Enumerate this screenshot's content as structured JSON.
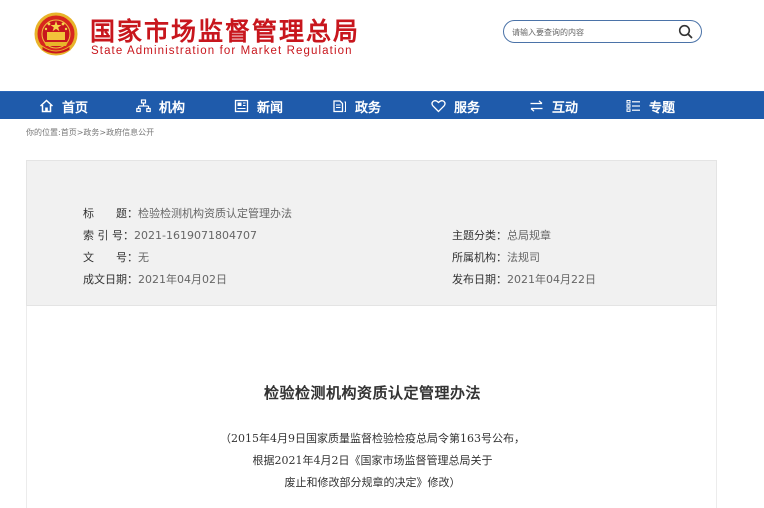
{
  "header": {
    "site_title": "国家市场监督管理总局",
    "site_subtitle": "State Administration for Market Regulation",
    "emblem_icon": "national-emblem-icon",
    "search_placeholder": "请输入要查询的内容",
    "brand_red": "#c8161d"
  },
  "nav": {
    "bg_color": "#1f5bab",
    "items": [
      {
        "label": "首页",
        "icon": "home-icon"
      },
      {
        "label": "机构",
        "icon": "org-chart-icon"
      },
      {
        "label": "新闻",
        "icon": "news-icon"
      },
      {
        "label": "政务",
        "icon": "government-affairs-icon"
      },
      {
        "label": "服务",
        "icon": "heart-icon"
      },
      {
        "label": "互动",
        "icon": "exchange-arrows-icon"
      },
      {
        "label": "专题",
        "icon": "topics-list-icon"
      }
    ]
  },
  "breadcrumb": "你的位置:首页>政务>政府信息公开",
  "meta": {
    "title_label": "标　　题：",
    "title_value": "检验检测机构资质认定管理办法",
    "index_label": "索 引 号：",
    "index_value": "2021-1619071804707",
    "doc_no_label": "文　　号：",
    "doc_no_value": "无",
    "created_label": "成文日期：",
    "created_value": "2021年04月02日",
    "category_label": "主题分类：",
    "category_value": "总局规章",
    "agency_label": "所属机构：",
    "agency_value": "法规司",
    "published_label": "发布日期：",
    "published_value": "2021年04月22日"
  },
  "document": {
    "title": "检验检测机构资质认定管理办法",
    "lines": [
      "（2015年4月9日国家质量监督检验检疫总局令第163号公布，",
      "根据2021年4月2日《国家市场监督管理总局关于",
      "废止和修改部分规章的决定》修改）"
    ]
  }
}
